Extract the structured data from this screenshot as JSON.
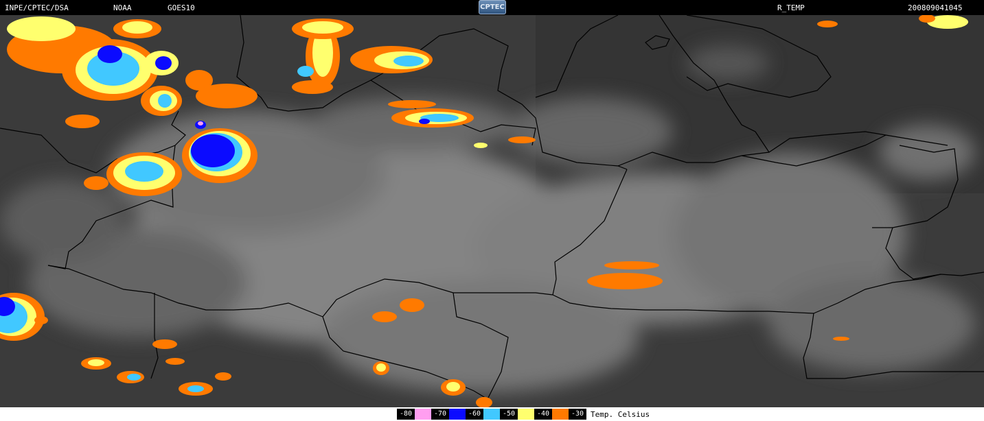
{
  "header": {
    "left_label": "INPE/CPTEC/DSA",
    "agency_label": "NOAA",
    "satellite_label": "GOES10",
    "logo_text": "CPTEC",
    "product_label": "R_TEMP",
    "timestamp": "200809041045"
  },
  "legend": {
    "items": [
      {
        "value": "-80",
        "color": "#ff9ef0"
      },
      {
        "value": "-70",
        "color": "#0b0bff"
      },
      {
        "value": "-60",
        "color": "#41c8ff"
      },
      {
        "value": "-50",
        "color": "#ffff6e"
      },
      {
        "value": "-40",
        "color": "#ff7a00"
      },
      {
        "value": "-30",
        "color": ""
      }
    ],
    "unit_label": "Temp. Celsius"
  },
  "colors": {
    "bar_background": "#000000",
    "cloud_gray": "#8f8f8f",
    "ground_dark": "#3a3a3a",
    "border_line": "#000000"
  }
}
